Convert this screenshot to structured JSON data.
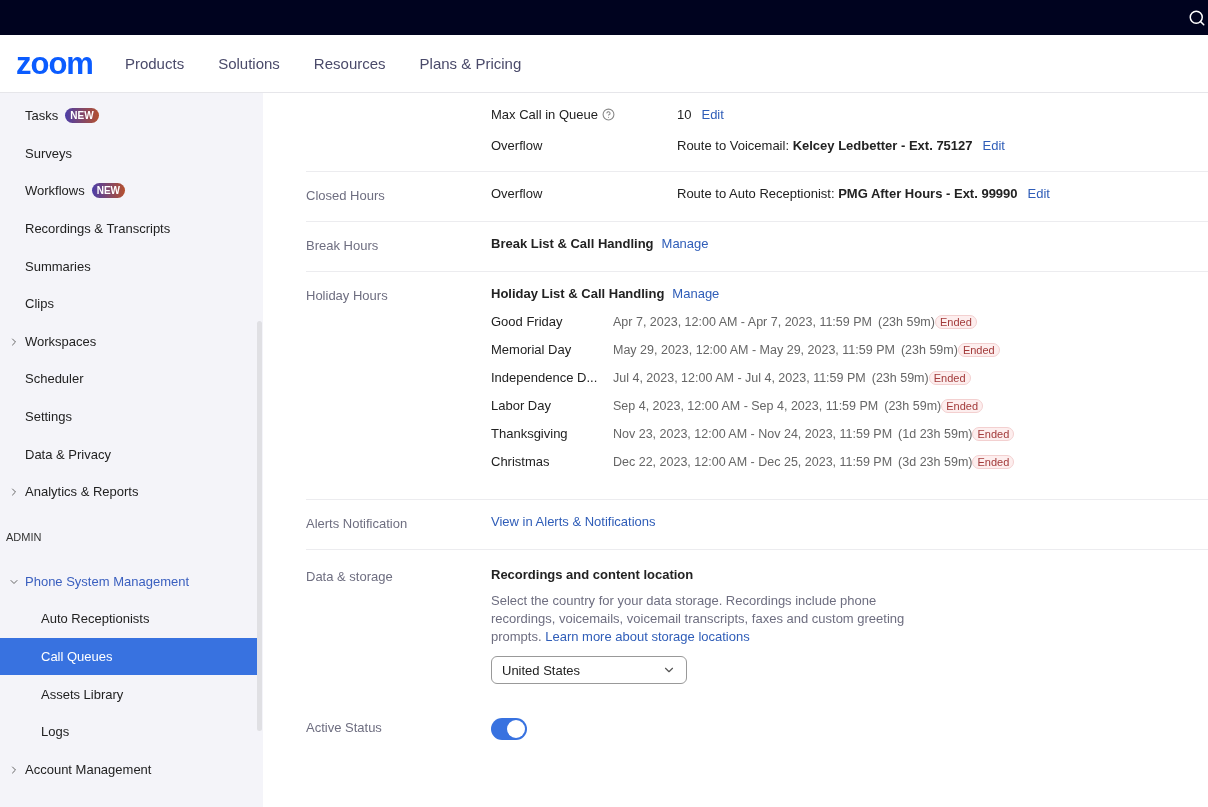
{
  "header": {
    "logo": "zoom",
    "nav": [
      "Products",
      "Solutions",
      "Resources",
      "Plans & Pricing"
    ]
  },
  "sidebar": [
    {
      "kind": "item",
      "label": "Tasks",
      "badge": "NEW",
      "selected": false
    },
    {
      "kind": "item",
      "label": "Surveys",
      "selected": false
    },
    {
      "kind": "item",
      "label": "Workflows",
      "badge": "NEW",
      "selected": false
    },
    {
      "kind": "item",
      "label": "Recordings & Transcripts",
      "selected": false
    },
    {
      "kind": "item",
      "label": "Summaries",
      "selected": false
    },
    {
      "kind": "item",
      "label": "Clips",
      "selected": false
    },
    {
      "kind": "item",
      "label": "Workspaces",
      "expanded": false,
      "selected": false
    },
    {
      "kind": "item",
      "label": "Scheduler",
      "selected": false
    },
    {
      "kind": "item",
      "label": "Settings",
      "selected": false
    },
    {
      "kind": "item",
      "label": "Data & Privacy",
      "selected": false
    },
    {
      "kind": "item",
      "label": "Analytics & Reports",
      "expanded": false,
      "selected": false
    },
    {
      "kind": "heading",
      "label": "ADMIN"
    },
    {
      "kind": "item",
      "label": "Phone System Management",
      "expanded": true,
      "selected": false,
      "children": [
        {
          "label": "Auto Receptionists",
          "selected": false
        },
        {
          "label": "Call Queues",
          "selected": true
        },
        {
          "label": "Assets Library",
          "selected": false
        },
        {
          "label": "Logs",
          "selected": false
        }
      ]
    },
    {
      "kind": "item",
      "label": "Account Management",
      "expanded": false,
      "selected": false
    }
  ],
  "sections": [
    {
      "kind": "fields",
      "rows": [
        {
          "name": "Max Call in Queue",
          "help": true,
          "value": "10",
          "action": "Edit"
        },
        {
          "name": "Overflow",
          "value": "Route to Voicemail: **Kelcey Ledbetter - Ext. 75127**",
          "action": "Edit"
        }
      ]
    },
    {
      "kind": "fields",
      "label": "Closed Hours",
      "rows": [
        {
          "name": "Overflow",
          "value": "Route to Auto Receptionist: **PMG After Hours - Ext. 99990**",
          "action": "Edit"
        }
      ]
    },
    {
      "kind": "list",
      "label": "Break Hours",
      "title": "Break List & Call Handling",
      "action": "Manage"
    },
    {
      "kind": "list",
      "label": "Holiday Hours",
      "title": "Holiday List & Call Handling",
      "action": "Manage",
      "holidays": [
        {
          "name": "Good Friday",
          "range": "Apr 7, 2023, 12:00 AM - Apr 7, 2023, 11:59 PM",
          "duration": "(23h 59m)",
          "status": "Ended"
        },
        {
          "name": "Memorial Day",
          "range": "May 29, 2023, 12:00 AM - May 29, 2023, 11:59 PM",
          "duration": "(23h 59m)",
          "status": "Ended"
        },
        {
          "name": "Independence D...",
          "range": "Jul 4, 2023, 12:00 AM - Jul 4, 2023, 11:59 PM",
          "duration": "(23h 59m)",
          "status": "Ended"
        },
        {
          "name": "Labor Day",
          "range": "Sep 4, 2023, 12:00 AM - Sep 4, 2023, 11:59 PM",
          "duration": "(23h 59m)",
          "status": "Ended"
        },
        {
          "name": "Thanksgiving",
          "range": "Nov 23, 2023, 12:00 AM - Nov 24, 2023, 11:59 PM",
          "duration": "(1d 23h 59m)",
          "status": "Ended"
        },
        {
          "name": "Christmas",
          "range": "Dec 22, 2023, 12:00 AM - Dec 25, 2023, 11:59 PM",
          "duration": "(3d 23h 59m)",
          "status": "Ended"
        }
      ]
    },
    {
      "kind": "link",
      "label": "Alerts Notification",
      "link": "View in Alerts & Notifications"
    },
    {
      "kind": "storage",
      "label": "Data & storage",
      "title": "Recordings and content location",
      "text": "Select the country for your data storage. Recordings include phone recordings, voicemails, voicemail transcripts, faxes and custom greeting prompts.",
      "link": "Learn more about storage locations",
      "select": "United States"
    },
    {
      "kind": "toggle",
      "label": "Active Status",
      "on": true
    }
  ]
}
